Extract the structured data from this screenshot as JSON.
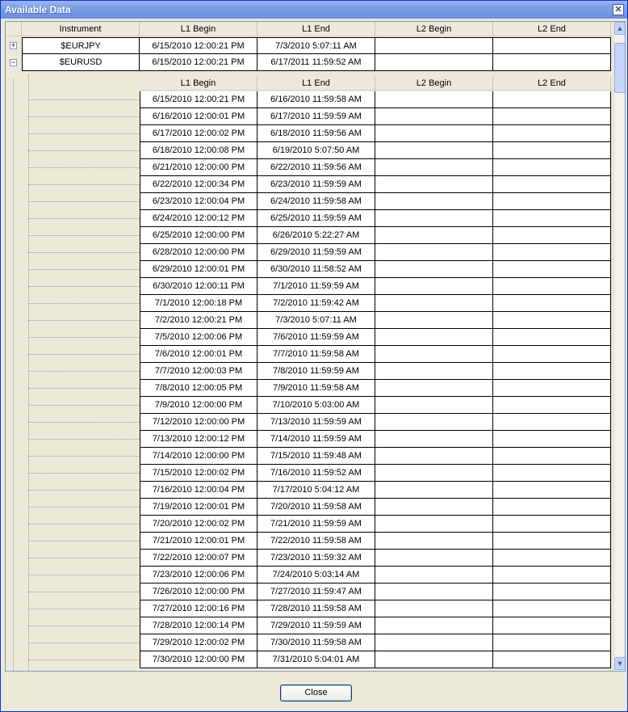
{
  "window": {
    "title": "Available Data",
    "close_symbol": "✕"
  },
  "columns": {
    "instrument": "Instrument",
    "l1_begin": "L1 Begin",
    "l1_end": "L1 End",
    "l2_begin": "L2 Begin",
    "l2_end": "L2 End"
  },
  "instruments": [
    {
      "name": "$EURJPY",
      "l1_begin": "6/15/2010 12:00:21 PM",
      "l1_end": "7/3/2010 5:07:11 AM",
      "l2_begin": "",
      "l2_end": "",
      "expanded": false,
      "expander_symbol": "+"
    },
    {
      "name": "$EURUSD",
      "l1_begin": "6/15/2010 12:00:21 PM",
      "l1_end": "6/17/2011 11:59:52 AM",
      "l2_begin": "",
      "l2_end": "",
      "expanded": true,
      "expander_symbol": "−"
    }
  ],
  "detail_rows": [
    {
      "l1_begin": "6/15/2010 12:00:21 PM",
      "l1_end": "6/16/2010 11:59:58 AM"
    },
    {
      "l1_begin": "6/16/2010 12:00:01 PM",
      "l1_end": "6/17/2010 11:59:59 AM"
    },
    {
      "l1_begin": "6/17/2010 12:00:02 PM",
      "l1_end": "6/18/2010 11:59:56 AM"
    },
    {
      "l1_begin": "6/18/2010 12:00:08 PM",
      "l1_end": "6/19/2010 5:07:50 AM"
    },
    {
      "l1_begin": "6/21/2010 12:00:00 PM",
      "l1_end": "6/22/2010 11:59:56 AM"
    },
    {
      "l1_begin": "6/22/2010 12:00:34 PM",
      "l1_end": "6/23/2010 11:59:59 AM"
    },
    {
      "l1_begin": "6/23/2010 12:00:04 PM",
      "l1_end": "6/24/2010 11:59:58 AM"
    },
    {
      "l1_begin": "6/24/2010 12:00:12 PM",
      "l1_end": "6/25/2010 11:59:59 AM"
    },
    {
      "l1_begin": "6/25/2010 12:00:00 PM",
      "l1_end": "6/26/2010 5:22:27 AM"
    },
    {
      "l1_begin": "6/28/2010 12:00:00 PM",
      "l1_end": "6/29/2010 11:59:59 AM"
    },
    {
      "l1_begin": "6/29/2010 12:00:01 PM",
      "l1_end": "6/30/2010 11:58:52 AM"
    },
    {
      "l1_begin": "6/30/2010 12:00:11 PM",
      "l1_end": "7/1/2010 11:59:59 AM"
    },
    {
      "l1_begin": "7/1/2010 12:00:18 PM",
      "l1_end": "7/2/2010 11:59:42 AM"
    },
    {
      "l1_begin": "7/2/2010 12:00:21 PM",
      "l1_end": "7/3/2010 5:07:11 AM"
    },
    {
      "l1_begin": "7/5/2010 12:00:06 PM",
      "l1_end": "7/6/2010 11:59:59 AM"
    },
    {
      "l1_begin": "7/6/2010 12:00:01 PM",
      "l1_end": "7/7/2010 11:59:58 AM"
    },
    {
      "l1_begin": "7/7/2010 12:00:03 PM",
      "l1_end": "7/8/2010 11:59:59 AM"
    },
    {
      "l1_begin": "7/8/2010 12:00:05 PM",
      "l1_end": "7/9/2010 11:59:58 AM"
    },
    {
      "l1_begin": "7/9/2010 12:00:00 PM",
      "l1_end": "7/10/2010 5:03:00 AM"
    },
    {
      "l1_begin": "7/12/2010 12:00:00 PM",
      "l1_end": "7/13/2010 11:59:59 AM"
    },
    {
      "l1_begin": "7/13/2010 12:00:12 PM",
      "l1_end": "7/14/2010 11:59:59 AM"
    },
    {
      "l1_begin": "7/14/2010 12:00:00 PM",
      "l1_end": "7/15/2010 11:59:48 AM"
    },
    {
      "l1_begin": "7/15/2010 12:00:02 PM",
      "l1_end": "7/16/2010 11:59:52 AM"
    },
    {
      "l1_begin": "7/16/2010 12:00:04 PM",
      "l1_end": "7/17/2010 5:04:12 AM"
    },
    {
      "l1_begin": "7/19/2010 12:00:01 PM",
      "l1_end": "7/20/2010 11:59:58 AM"
    },
    {
      "l1_begin": "7/20/2010 12:00:02 PM",
      "l1_end": "7/21/2010 11:59:59 AM"
    },
    {
      "l1_begin": "7/21/2010 12:00:01 PM",
      "l1_end": "7/22/2010 11:59:58 AM"
    },
    {
      "l1_begin": "7/22/2010 12:00:07 PM",
      "l1_end": "7/23/2010 11:59:32 AM"
    },
    {
      "l1_begin": "7/23/2010 12:00:06 PM",
      "l1_end": "7/24/2010 5:03:14 AM"
    },
    {
      "l1_begin": "7/26/2010 12:00:00 PM",
      "l1_end": "7/27/2010 11:59:47 AM"
    },
    {
      "l1_begin": "7/27/2010 12:00:16 PM",
      "l1_end": "7/28/2010 11:59:58 AM"
    },
    {
      "l1_begin": "7/28/2010 12:00:14 PM",
      "l1_end": "7/29/2010 11:59:59 AM"
    },
    {
      "l1_begin": "7/29/2010 12:00:02 PM",
      "l1_end": "7/30/2010 11:59:58 AM"
    },
    {
      "l1_begin": "7/30/2010 12:00:00 PM",
      "l1_end": "7/31/2010 5:04:01 AM"
    }
  ],
  "scrollbar": {
    "up_symbol": "▲",
    "down_symbol": "▼"
  },
  "buttons": {
    "close_label": "Close"
  }
}
